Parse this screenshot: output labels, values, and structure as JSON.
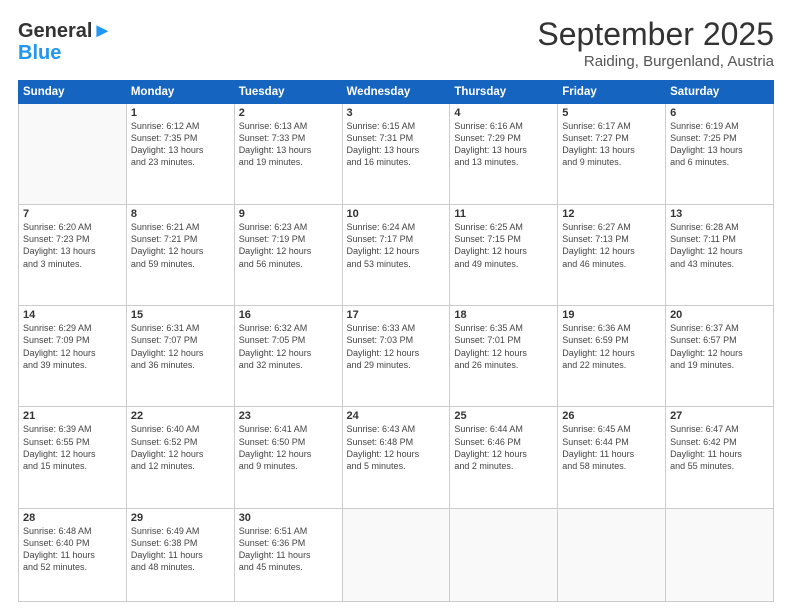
{
  "header": {
    "logo_general": "General",
    "logo_blue": "Blue",
    "month": "September 2025",
    "location": "Raiding, Burgenland, Austria"
  },
  "weekdays": [
    "Sunday",
    "Monday",
    "Tuesday",
    "Wednesday",
    "Thursday",
    "Friday",
    "Saturday"
  ],
  "weeks": [
    [
      {
        "day": "",
        "info": ""
      },
      {
        "day": "1",
        "info": "Sunrise: 6:12 AM\nSunset: 7:35 PM\nDaylight: 13 hours\nand 23 minutes."
      },
      {
        "day": "2",
        "info": "Sunrise: 6:13 AM\nSunset: 7:33 PM\nDaylight: 13 hours\nand 19 minutes."
      },
      {
        "day": "3",
        "info": "Sunrise: 6:15 AM\nSunset: 7:31 PM\nDaylight: 13 hours\nand 16 minutes."
      },
      {
        "day": "4",
        "info": "Sunrise: 6:16 AM\nSunset: 7:29 PM\nDaylight: 13 hours\nand 13 minutes."
      },
      {
        "day": "5",
        "info": "Sunrise: 6:17 AM\nSunset: 7:27 PM\nDaylight: 13 hours\nand 9 minutes."
      },
      {
        "day": "6",
        "info": "Sunrise: 6:19 AM\nSunset: 7:25 PM\nDaylight: 13 hours\nand 6 minutes."
      }
    ],
    [
      {
        "day": "7",
        "info": "Sunrise: 6:20 AM\nSunset: 7:23 PM\nDaylight: 13 hours\nand 3 minutes."
      },
      {
        "day": "8",
        "info": "Sunrise: 6:21 AM\nSunset: 7:21 PM\nDaylight: 12 hours\nand 59 minutes."
      },
      {
        "day": "9",
        "info": "Sunrise: 6:23 AM\nSunset: 7:19 PM\nDaylight: 12 hours\nand 56 minutes."
      },
      {
        "day": "10",
        "info": "Sunrise: 6:24 AM\nSunset: 7:17 PM\nDaylight: 12 hours\nand 53 minutes."
      },
      {
        "day": "11",
        "info": "Sunrise: 6:25 AM\nSunset: 7:15 PM\nDaylight: 12 hours\nand 49 minutes."
      },
      {
        "day": "12",
        "info": "Sunrise: 6:27 AM\nSunset: 7:13 PM\nDaylight: 12 hours\nand 46 minutes."
      },
      {
        "day": "13",
        "info": "Sunrise: 6:28 AM\nSunset: 7:11 PM\nDaylight: 12 hours\nand 43 minutes."
      }
    ],
    [
      {
        "day": "14",
        "info": "Sunrise: 6:29 AM\nSunset: 7:09 PM\nDaylight: 12 hours\nand 39 minutes."
      },
      {
        "day": "15",
        "info": "Sunrise: 6:31 AM\nSunset: 7:07 PM\nDaylight: 12 hours\nand 36 minutes."
      },
      {
        "day": "16",
        "info": "Sunrise: 6:32 AM\nSunset: 7:05 PM\nDaylight: 12 hours\nand 32 minutes."
      },
      {
        "day": "17",
        "info": "Sunrise: 6:33 AM\nSunset: 7:03 PM\nDaylight: 12 hours\nand 29 minutes."
      },
      {
        "day": "18",
        "info": "Sunrise: 6:35 AM\nSunset: 7:01 PM\nDaylight: 12 hours\nand 26 minutes."
      },
      {
        "day": "19",
        "info": "Sunrise: 6:36 AM\nSunset: 6:59 PM\nDaylight: 12 hours\nand 22 minutes."
      },
      {
        "day": "20",
        "info": "Sunrise: 6:37 AM\nSunset: 6:57 PM\nDaylight: 12 hours\nand 19 minutes."
      }
    ],
    [
      {
        "day": "21",
        "info": "Sunrise: 6:39 AM\nSunset: 6:55 PM\nDaylight: 12 hours\nand 15 minutes."
      },
      {
        "day": "22",
        "info": "Sunrise: 6:40 AM\nSunset: 6:52 PM\nDaylight: 12 hours\nand 12 minutes."
      },
      {
        "day": "23",
        "info": "Sunrise: 6:41 AM\nSunset: 6:50 PM\nDaylight: 12 hours\nand 9 minutes."
      },
      {
        "day": "24",
        "info": "Sunrise: 6:43 AM\nSunset: 6:48 PM\nDaylight: 12 hours\nand 5 minutes."
      },
      {
        "day": "25",
        "info": "Sunrise: 6:44 AM\nSunset: 6:46 PM\nDaylight: 12 hours\nand 2 minutes."
      },
      {
        "day": "26",
        "info": "Sunrise: 6:45 AM\nSunset: 6:44 PM\nDaylight: 11 hours\nand 58 minutes."
      },
      {
        "day": "27",
        "info": "Sunrise: 6:47 AM\nSunset: 6:42 PM\nDaylight: 11 hours\nand 55 minutes."
      }
    ],
    [
      {
        "day": "28",
        "info": "Sunrise: 6:48 AM\nSunset: 6:40 PM\nDaylight: 11 hours\nand 52 minutes."
      },
      {
        "day": "29",
        "info": "Sunrise: 6:49 AM\nSunset: 6:38 PM\nDaylight: 11 hours\nand 48 minutes."
      },
      {
        "day": "30",
        "info": "Sunrise: 6:51 AM\nSunset: 6:36 PM\nDaylight: 11 hours\nand 45 minutes."
      },
      {
        "day": "",
        "info": ""
      },
      {
        "day": "",
        "info": ""
      },
      {
        "day": "",
        "info": ""
      },
      {
        "day": "",
        "info": ""
      }
    ]
  ]
}
